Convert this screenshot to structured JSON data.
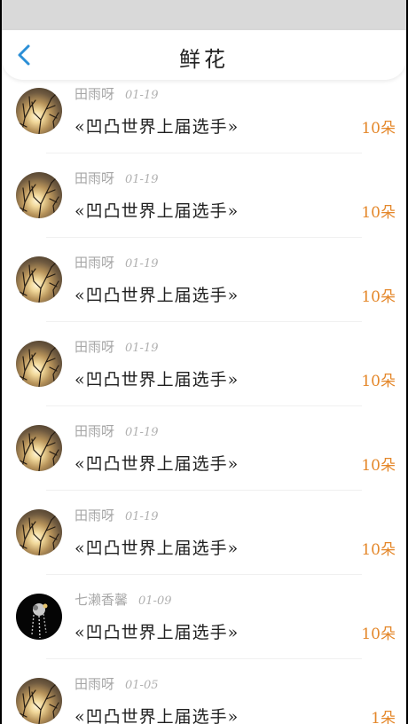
{
  "header": {
    "title": "鲜花",
    "back_icon": "chevron-left-icon",
    "accent_color": "#2b8fd6"
  },
  "colors": {
    "status_bar": "#d9d9d9",
    "count_text": "#e4872a",
    "meta_text": "#a7a7a7"
  },
  "records": [
    {
      "avatar": "sunset-branches",
      "name": "田雨呀",
      "date": "01-19",
      "gift": "«凹凸世界上届选手»",
      "count": "10朵"
    },
    {
      "avatar": "sunset-branches",
      "name": "田雨呀",
      "date": "01-19",
      "gift": "«凹凸世界上届选手»",
      "count": "10朵"
    },
    {
      "avatar": "sunset-branches",
      "name": "田雨呀",
      "date": "01-19",
      "gift": "«凹凸世界上届选手»",
      "count": "10朵"
    },
    {
      "avatar": "sunset-branches",
      "name": "田雨呀",
      "date": "01-19",
      "gift": "«凹凸世界上届选手»",
      "count": "10朵"
    },
    {
      "avatar": "sunset-branches",
      "name": "田雨呀",
      "date": "01-19",
      "gift": "«凹凸世界上届选手»",
      "count": "10朵"
    },
    {
      "avatar": "sunset-branches",
      "name": "田雨呀",
      "date": "01-19",
      "gift": "«凹凸世界上届选手»",
      "count": "10朵"
    },
    {
      "avatar": "dark-figure",
      "name": "七濑香馨",
      "date": "01-09",
      "gift": "«凹凸世界上届选手»",
      "count": "10朵"
    },
    {
      "avatar": "sunset-branches",
      "name": "田雨呀",
      "date": "01-05",
      "gift": "«凹凸世界上届选手»",
      "count": "1朵"
    }
  ]
}
